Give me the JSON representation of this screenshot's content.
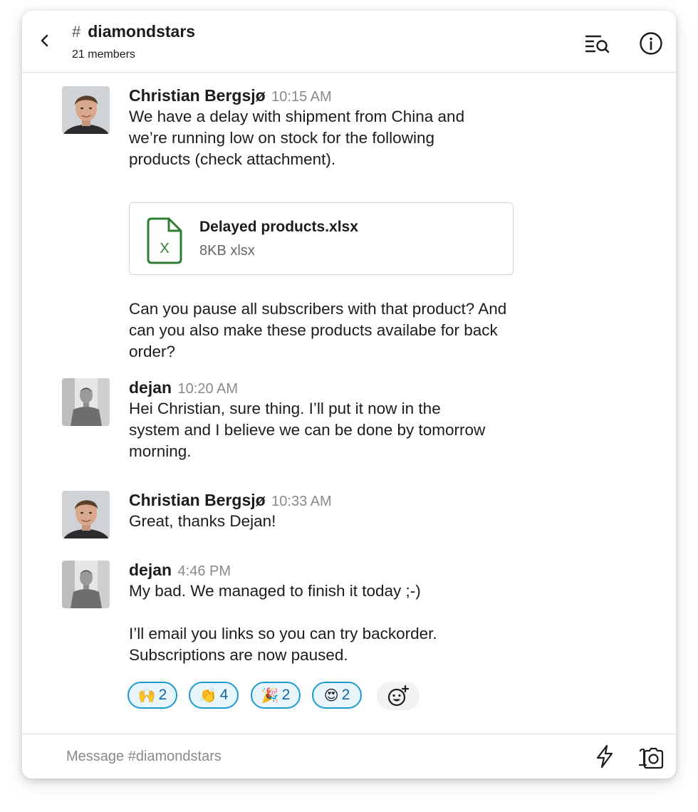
{
  "header": {
    "hash": "#",
    "channel_name": "diamondstars",
    "members": "21 members",
    "icons": {
      "back": "chevron-left-icon",
      "search": "channel-search-icon",
      "info": "info-icon"
    }
  },
  "messages": [
    {
      "sender": "Christian Bergsjø",
      "time": "10:15 AM",
      "avatar": "christian",
      "paragraphs": [
        "We have a delay with shipment from China and we’re running low on stock for the following products (check attachment)."
      ],
      "attachment": {
        "name": "Delayed products.xlsx",
        "meta": "8KB xlsx",
        "icon": "spreadsheet-file-icon",
        "icon_letter": "X"
      },
      "after_attachment": "Can you pause all subscribers with that product? And can you also make these products availabe for back order?"
    },
    {
      "sender": "dejan",
      "time": "10:20 AM",
      "avatar": "dejan",
      "paragraphs": [
        "Hei Christian, sure thing. I’ll put it now in the system and I believe we can be done by tomorrow morning."
      ]
    },
    {
      "sender": "Christian Bergsjø",
      "time": "10:33 AM",
      "avatar": "christian",
      "paragraphs": [
        "Great, thanks Dejan!"
      ]
    },
    {
      "sender": "dejan",
      "time": "4:46 PM",
      "avatar": "dejan",
      "paragraphs": [
        "My bad. We managed to finish it today ;-)",
        "I’ll email you links so you can try backorder. Subscriptions are now paused."
      ]
    }
  ],
  "reactions": [
    {
      "emoji": "🙌",
      "name": "raised-hands-emoji",
      "count": "2"
    },
    {
      "emoji": "👏",
      "name": "clapping-hands-emoji",
      "count": "4"
    },
    {
      "emoji": "🎉",
      "name": "party-popper-emoji",
      "count": "2"
    },
    {
      "emoji": "😍",
      "name": "heart-eyes-emoji",
      "count": "2"
    }
  ],
  "composer": {
    "placeholder": "Message #diamondstars",
    "icons": {
      "shortcuts": "lightning-icon",
      "camera": "camera-icon",
      "add_reaction": "add-emoji-icon"
    }
  },
  "colors": {
    "reaction_border": "#1d9bd1",
    "reaction_bg": "#e8f5fa",
    "reaction_count": "#1264a3",
    "excel_green": "#2e7d32",
    "text": "#1d1c1d",
    "muted": "#8a8a8a"
  }
}
